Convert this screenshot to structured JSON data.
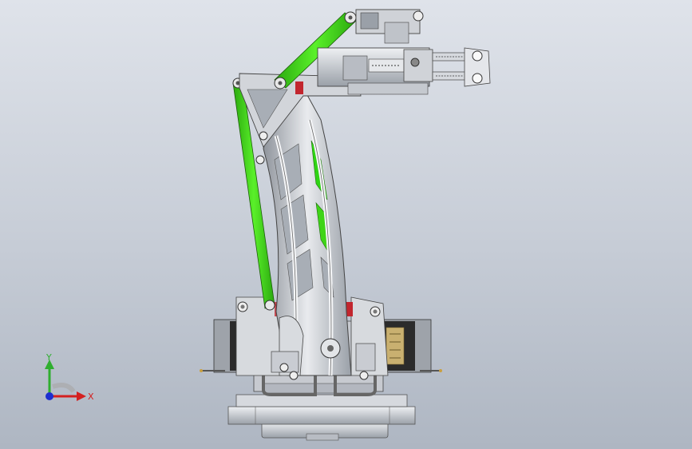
{
  "triad": {
    "y_label": "Y",
    "x_label": "X"
  },
  "colors": {
    "link_green": "#3fd417",
    "frame_gray": "#c9ccd2",
    "motor_dark": "#2b2b2b",
    "label_tan": "#c9b070",
    "axis_y": "#2fae2f",
    "axis_x": "#d42020",
    "axis_z": "#1c2fd0",
    "accent_red": "#c2262e"
  }
}
